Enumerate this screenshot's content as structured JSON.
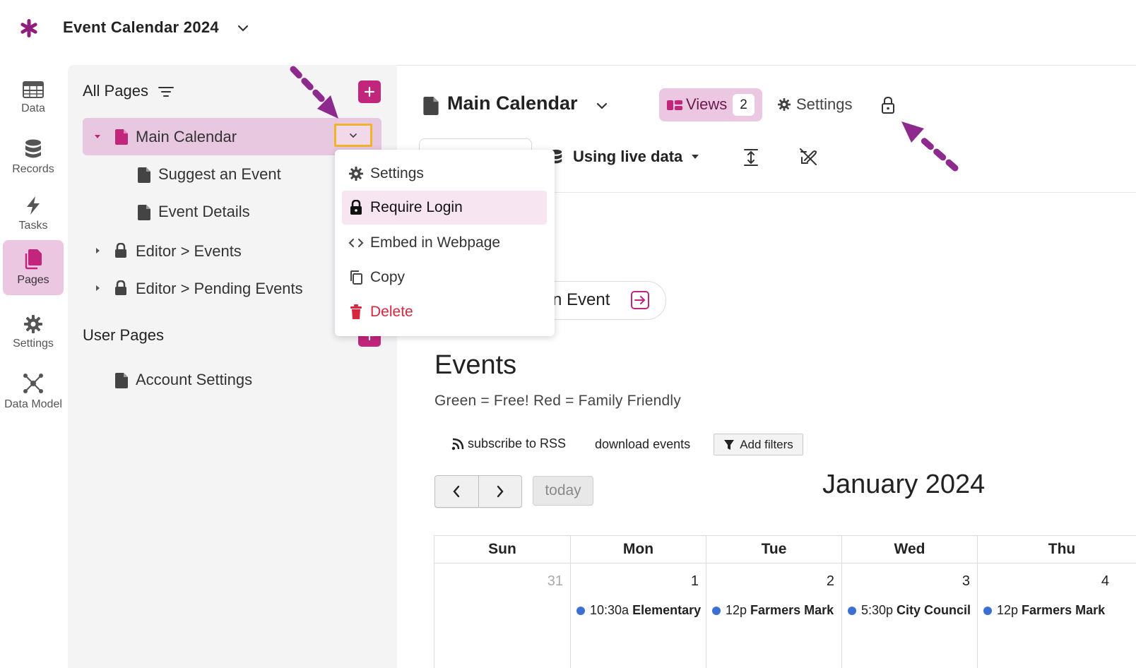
{
  "app": {
    "title": "Event Calendar 2024"
  },
  "nav": {
    "items": [
      {
        "label": "Data",
        "icon": "table-icon"
      },
      {
        "label": "Records",
        "icon": "database-icon"
      },
      {
        "label": "Tasks",
        "icon": "bolt-icon"
      },
      {
        "label": "Pages",
        "icon": "pages-icon",
        "active": true
      },
      {
        "label": "Settings",
        "icon": "gear-icon"
      },
      {
        "label": "Data Model",
        "icon": "graph-icon"
      }
    ]
  },
  "pages_panel": {
    "all_pages_title": "All Pages",
    "tree": [
      {
        "label": "Main Calendar",
        "selected": true
      },
      {
        "label": "Suggest an Event"
      },
      {
        "label": "Event Details"
      },
      {
        "label": "Editor > Events",
        "locked": true
      },
      {
        "label": "Editor > Pending Events",
        "locked": true
      }
    ],
    "user_pages_title": "User Pages",
    "user_pages": [
      {
        "label": "Account Settings"
      }
    ]
  },
  "row_menu": {
    "items": [
      {
        "label": "Settings",
        "icon": "gear-icon"
      },
      {
        "label": "Require Login",
        "icon": "lock-icon",
        "hover": true
      },
      {
        "label": "Embed in Webpage",
        "icon": "code-icon"
      },
      {
        "label": "Copy",
        "icon": "copy-icon"
      },
      {
        "label": "Delete",
        "icon": "trash-icon",
        "danger": true
      }
    ]
  },
  "header": {
    "page_title": "Main Calendar",
    "views_label": "Views",
    "views_count": "2",
    "settings_label": "Settings"
  },
  "toolbar": {
    "live_data_label": "Using live data"
  },
  "content": {
    "event_button_label": "n Event",
    "events_heading": "Events",
    "events_desc": "Green = Free! Red = Family Friendly",
    "rss_label": "subscribe to RSS",
    "download_label": "download events",
    "filters_label": "Add filters",
    "today_label": "today",
    "month_title": "January 2024"
  },
  "calendar": {
    "headers": [
      "Sun",
      "Mon",
      "Tue",
      "Wed",
      "Thu"
    ],
    "cells": [
      {
        "day": "31",
        "muted": true
      },
      {
        "day": "1",
        "event_time": "10:30a",
        "event_title": "Elementary"
      },
      {
        "day": "2",
        "event_time": "12p",
        "event_title": "Farmers Mark"
      },
      {
        "day": "3",
        "event_time": "5:30p",
        "event_title": "City Council"
      },
      {
        "day": "4",
        "event_time": "12p",
        "event_title": "Farmers Mark"
      }
    ]
  },
  "colors": {
    "accent": "#c2257c",
    "accent_light": "#ebc7e1",
    "highlight": "#f0b429",
    "annotation_arrow": "#8e2a8e",
    "danger": "#d7263d",
    "event_dot": "#3b6fd4"
  }
}
